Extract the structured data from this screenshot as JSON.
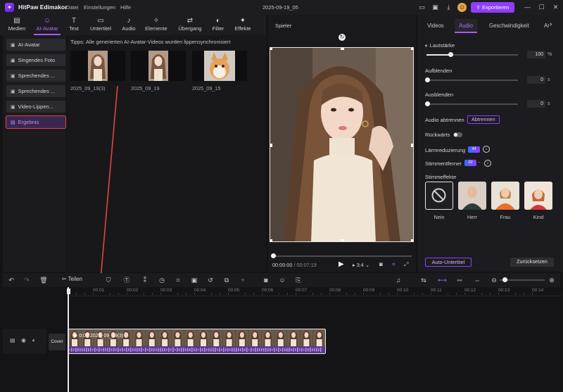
{
  "app": {
    "name": "HitPaw Edimakor",
    "menu": [
      "Datei",
      "Einstellungen",
      "Hilfe"
    ],
    "document_title": "2025-09-19_05",
    "export_label": "Exportieren"
  },
  "toolbar": [
    {
      "label": "Medien",
      "icon": "folder-icon"
    },
    {
      "label": "AI-Avatar",
      "icon": "avatar-icon"
    },
    {
      "label": "Text",
      "icon": "text-icon"
    },
    {
      "label": "Untertitel",
      "icon": "subtitle-icon"
    },
    {
      "label": "Audio",
      "icon": "music-icon"
    },
    {
      "label": "Elemente",
      "icon": "elements-icon"
    },
    {
      "label": "Übergang",
      "icon": "transition-icon"
    },
    {
      "label": "Filter",
      "icon": "filter-icon"
    },
    {
      "label": "Effekte",
      "icon": "effects-icon"
    }
  ],
  "categories": [
    {
      "label": "AI-Avatar"
    },
    {
      "label": "Singendes Foto"
    },
    {
      "label": "Sprechendes ..."
    },
    {
      "label": "Sprechendes ..."
    },
    {
      "label": "Video-Lippen..."
    },
    {
      "label": "Ergebnis"
    }
  ],
  "media": {
    "tips": "Tipps: Alle generierten AI-Avatar-Videos wurden lippensynchronisiert",
    "items": [
      {
        "label": "2025_09_19(3)"
      },
      {
        "label": "2025_09_19"
      },
      {
        "label": "2025_09_15"
      }
    ]
  },
  "player": {
    "title": "Spieler",
    "current_time": "00:00:00",
    "total_time": "/ 00:07:19",
    "aspect": "3:4"
  },
  "right_panel": {
    "tabs": [
      "Videos",
      "Audio",
      "Geschwindigkeit",
      "Ar"
    ],
    "volume_label": "Lautstärke",
    "volume_value": "100",
    "volume_unit": "%",
    "volume_fraction": 1.0,
    "fade_in_label": "Aufblenden",
    "fade_in_value": "0",
    "fade_out_label": "Ausblenden",
    "fade_out_value": "0",
    "seconds_unit": "s",
    "detach_label": "Audio abtrennen",
    "detach_button": "Abtrennen",
    "reverse_label": "Rückwärts",
    "noise_label": "Lärmreduzierung",
    "vocal_label": "Stimmentferner",
    "ai_badge": "AI",
    "effects_label": "Stimmeffekte",
    "voices": [
      {
        "label": "Nein"
      },
      {
        "label": "Herr"
      },
      {
        "label": "Frau"
      },
      {
        "label": "Kind"
      }
    ],
    "auto_subtitle": "Auto-Untertitel",
    "reset": "Zurücksetzen"
  },
  "timeline": {
    "split_label": "Teilen",
    "ticks": [
      "00:00",
      "00:01",
      "00:02",
      "00:03",
      "00:04",
      "00:05",
      "00:06",
      "00:07",
      "00:08",
      "00:09",
      "00:10",
      "00:11",
      "00:12",
      "00:13",
      "00:14"
    ],
    "cover_label": "Cover",
    "clip_label": "0:07  2025_09_19(3)"
  },
  "colors": {
    "accent": "#8f3dff",
    "highlight": "#e0473f"
  }
}
